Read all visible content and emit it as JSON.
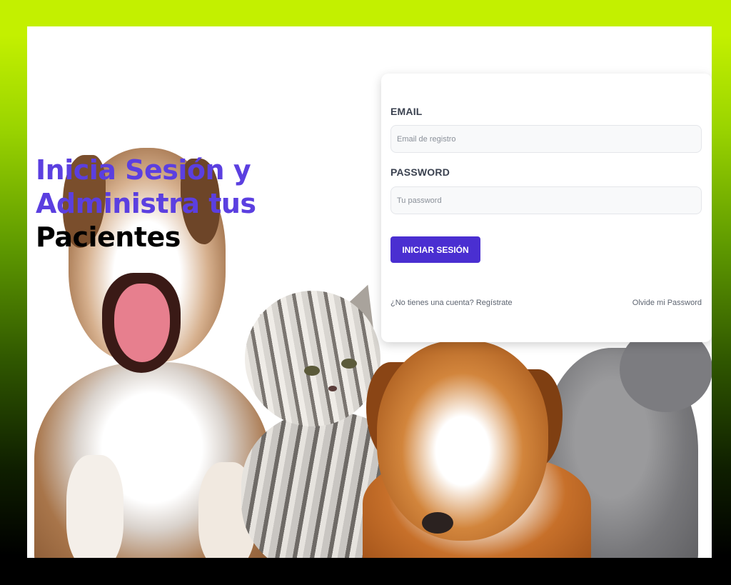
{
  "headline": {
    "line1": "Inicia Sesión y",
    "line2": "Administra tus",
    "line3": "Pacientes"
  },
  "login": {
    "email_label": "EMAIL",
    "email_placeholder": "Email de registro",
    "password_label": "PASSWORD",
    "password_placeholder": "Tu password",
    "submit_label": "INICIAR SESIÓN",
    "register_link": "¿No tienes una cuenta? Regístrate",
    "forgot_link": "Olvide mi Password"
  },
  "colors": {
    "accent": "#5b3fe0",
    "button": "#4a2fd1",
    "frame_top": "#c3f000",
    "frame_bottom": "#000000"
  },
  "icons": [
    "pets-illustration"
  ]
}
